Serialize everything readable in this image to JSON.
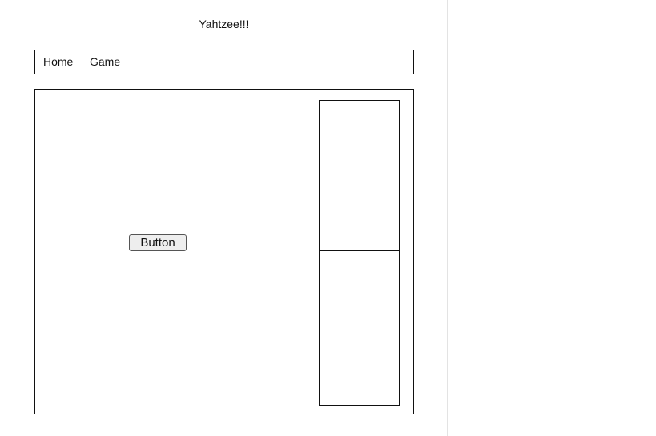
{
  "header": {
    "title": "Yahtzee!!!"
  },
  "nav": {
    "items": [
      {
        "label": "Home"
      },
      {
        "label": "Game"
      }
    ]
  },
  "main": {
    "button_label": "Button"
  },
  "colors": {
    "border": "#111111",
    "divider": "#e3e3e3",
    "button_bg": "#eeeeee"
  }
}
